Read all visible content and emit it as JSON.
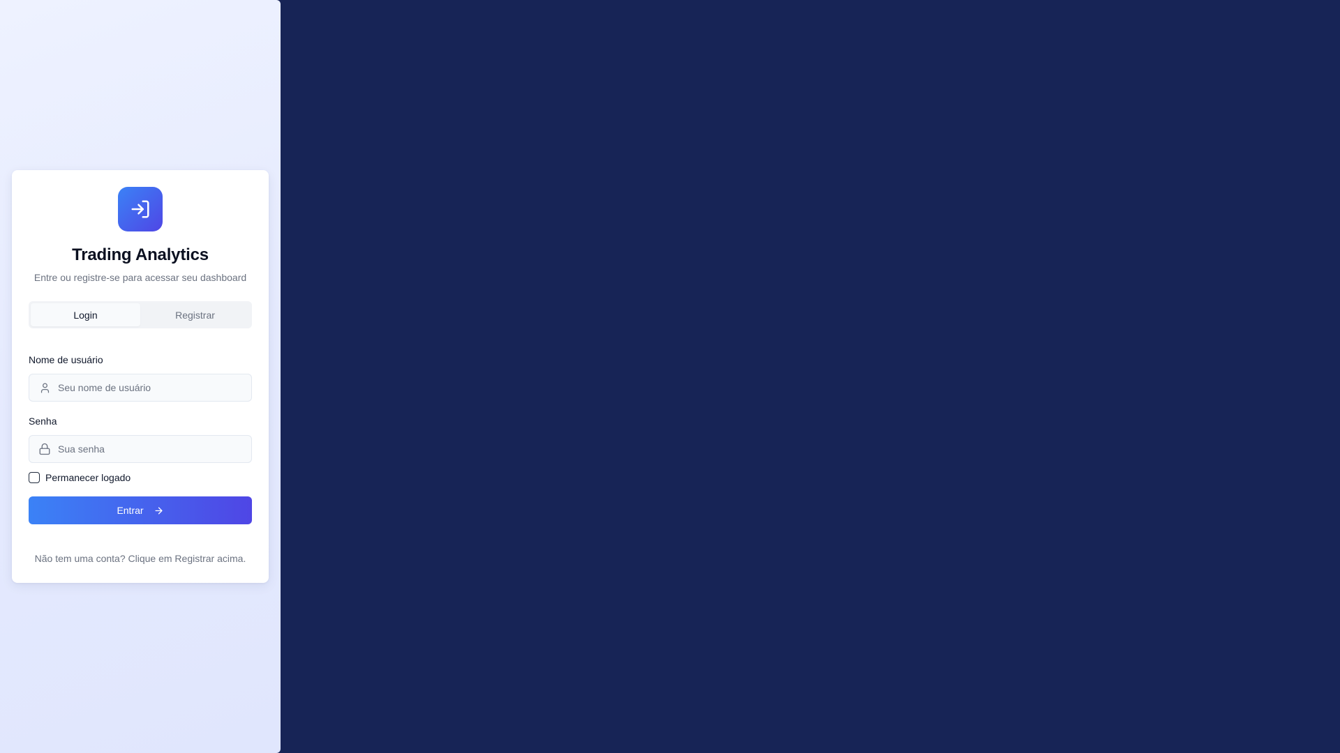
{
  "app": {
    "title": "Trading Analytics",
    "subtitle": "Entre ou registre-se para acessar seu dashboard",
    "logo_icon": "log-in-icon"
  },
  "tabs": [
    {
      "label": "Login",
      "active": true
    },
    {
      "label": "Registrar",
      "active": false
    }
  ],
  "form": {
    "username": {
      "label": "Nome de usuário",
      "placeholder": "Seu nome de usuário",
      "value": "",
      "icon": "user-icon"
    },
    "password": {
      "label": "Senha",
      "placeholder": "Sua senha",
      "value": "",
      "icon": "lock-icon"
    },
    "remember": {
      "label": "Permanecer logado",
      "checked": false
    },
    "submit_label": "Entrar",
    "submit_icon": "arrow-right-icon"
  },
  "footer": {
    "text": "Não tem uma conta? Clique em Registrar acima."
  },
  "colors": {
    "background": "#172456",
    "panel": "#eef2ff",
    "accent_start": "#3b82f6",
    "accent_end": "#4f46e5",
    "muted_text": "#6b7280"
  }
}
